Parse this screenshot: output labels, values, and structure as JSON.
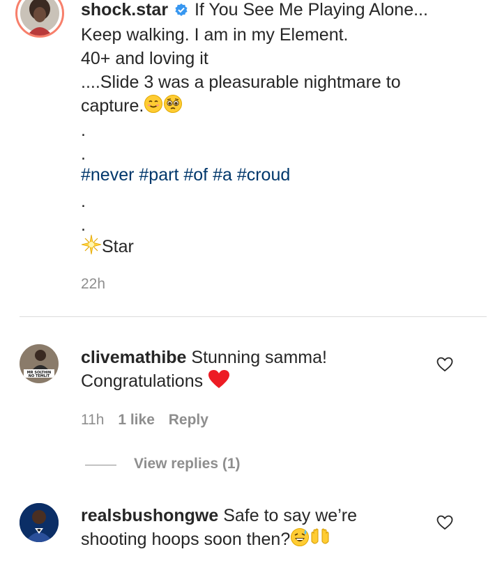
{
  "post": {
    "username": "shock.star",
    "caption_line1": "If You See Me Playing Alone...",
    "caption_line2": "Keep walking. I am in my Element.",
    "caption_line3": "40+ and loving it",
    "caption_line4": "....Slide 3 was a pleasurable nightmare to",
    "caption_line5": "capture.",
    "dot": ".",
    "hashtags": [
      "#never",
      "#part",
      "#of",
      "#a",
      "#croud"
    ],
    "signature": "Star",
    "time": "22h"
  },
  "comments": [
    {
      "username": "clivemathibe",
      "text_line1": "Stunning samma!",
      "text_line2": "Congratulations",
      "time": "11h",
      "likes": "1 like",
      "reply": "Reply",
      "view_replies": "View replies (1)",
      "avatar_text": "MR SOLTHIN NO TEMLIT"
    },
    {
      "username": "realsbushongwe",
      "text_line1": "Safe to say we’re",
      "text_line2": "shooting hoops soon then?"
    }
  ],
  "colors": {
    "text": "#262626",
    "hashtag": "#00376b",
    "meta": "#8e8e8e",
    "verified": "#3897f0",
    "heart": "#ed1c24"
  }
}
